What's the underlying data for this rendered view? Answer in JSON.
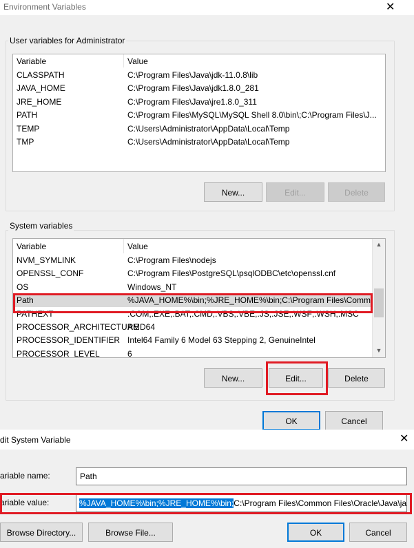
{
  "env_dialog": {
    "title": "Environment Variables",
    "user_group_label": "User variables for Administrator",
    "system_group_label": "System variables",
    "columns": [
      "Variable",
      "Value"
    ],
    "user_vars": [
      {
        "name": "CLASSPATH",
        "value": "C:\\Program Files\\Java\\jdk-11.0.8\\lib"
      },
      {
        "name": "JAVA_HOME",
        "value": "C:\\Program Files\\Java\\jdk1.8.0_281"
      },
      {
        "name": "JRE_HOME",
        "value": "C:\\Program Files\\Java\\jre1.8.0_311"
      },
      {
        "name": "PATH",
        "value": "C:\\Program Files\\MySQL\\MySQL Shell 8.0\\bin\\;C:\\Program Files\\J..."
      },
      {
        "name": "TEMP",
        "value": "C:\\Users\\Administrator\\AppData\\Local\\Temp"
      },
      {
        "name": "TMP",
        "value": "C:\\Users\\Administrator\\AppData\\Local\\Temp"
      }
    ],
    "system_vars": [
      {
        "name": "NVM_SYMLINK",
        "value": "C:\\Program Files\\nodejs"
      },
      {
        "name": "OPENSSL_CONF",
        "value": "C:\\Program Files\\PostgreSQL\\psqlODBC\\etc\\openssl.cnf"
      },
      {
        "name": "OS",
        "value": "Windows_NT"
      },
      {
        "name": "Path",
        "value": "%JAVA_HOME%\\bin;%JRE_HOME%\\bin;C:\\Program Files\\Comm..."
      },
      {
        "name": "PATHEXT",
        "value": ".COM;.EXE;.BAT;.CMD;.VBS;.VBE;.JS;.JSE;.WSF;.WSH;.MSC"
      },
      {
        "name": "PROCESSOR_ARCHITECTURE",
        "value": "AMD64"
      },
      {
        "name": "PROCESSOR_IDENTIFIER",
        "value": "Intel64 Family 6 Model 63 Stepping 2, GenuineIntel"
      },
      {
        "name": "PROCESSOR_LEVEL",
        "value": "6"
      }
    ],
    "selected_system_var": "Path",
    "buttons": {
      "user_new": "New...",
      "user_edit": "Edit...",
      "user_delete": "Delete",
      "sys_new": "New...",
      "sys_edit": "Edit...",
      "sys_delete": "Delete",
      "ok": "OK",
      "cancel": "Cancel"
    },
    "disabled_buttons": [
      "user_edit",
      "user_delete"
    ]
  },
  "edit_dialog": {
    "title": "dit System Variable",
    "name_label": "ariable name:",
    "name_value": "Path",
    "value_label": "ariable value:",
    "value_selected": "%JAVA_HOME%\\bin;%JRE_HOME%\\bin;",
    "value_rest": "C:\\Program Files\\Common Files\\Oracle\\Java\\javap",
    "buttons": {
      "browse_directory": "Browse Directory...",
      "browse_file": "Browse File...",
      "ok": "OK",
      "cancel": "Cancel"
    }
  },
  "icons": {
    "close": "close-icon",
    "scroll_up": "chevron-up-icon",
    "scroll_down": "chevron-down-icon"
  },
  "colors": {
    "highlight": "#e01b24",
    "selection": "#0078d7"
  }
}
